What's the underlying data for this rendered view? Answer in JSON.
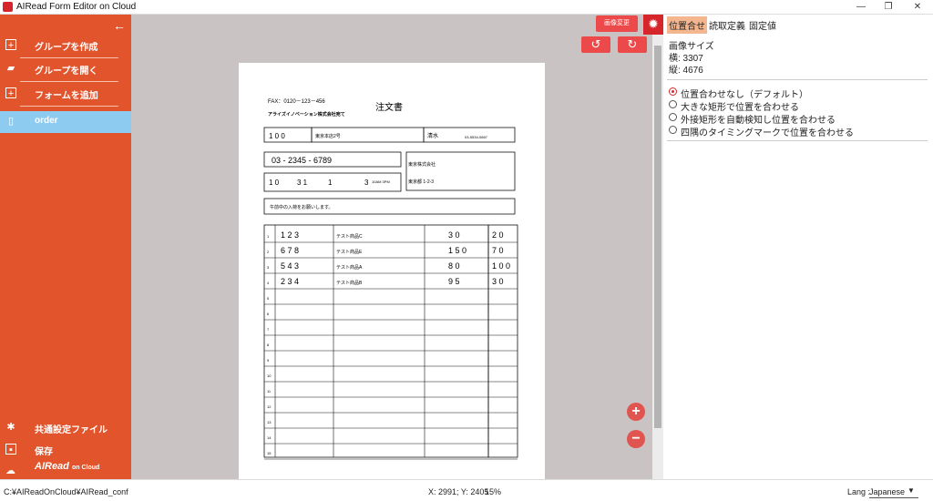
{
  "window": {
    "title": "AIRead Form Editor on Cloud",
    "min": "—",
    "max": "❐",
    "close": "✕"
  },
  "sidebar": {
    "back": "←",
    "items": [
      {
        "label": "グループを作成",
        "icon": "plus-square-icon"
      },
      {
        "label": "グループを開く",
        "icon": "folder-open-icon"
      },
      {
        "label": "フォームを追加",
        "icon": "plus-square-icon"
      },
      {
        "label": "order",
        "icon": "document-icon"
      }
    ],
    "bottom": [
      {
        "label": "共通設定ファイル",
        "icon": "gear-icon"
      },
      {
        "label": "保存",
        "icon": "save-icon"
      }
    ],
    "logo": "AIRead",
    "logo_suffix": "on Cloud"
  },
  "toolbar": {
    "image_change": "画像変更",
    "rotate_left": "↺",
    "rotate_right": "↻",
    "zoom_in": "+",
    "zoom_out": "−"
  },
  "document": {
    "fax": "FAX：0120－123－456",
    "title": "注文書",
    "to": "アライズイノベーション株式会社宛て",
    "customer_code": "1 0 0",
    "customer_name": "東京本店2号",
    "contact": "清水",
    "phone_small": "03-5534-0667",
    "phone": "03 - 2345 - 6789",
    "company": "東京株式会社",
    "date_digits": "1 0",
    "date_day": "3 1",
    "option1": "1",
    "option2": "3",
    "time_opts": "10AM 3PM",
    "address": "東京都 1-2-3",
    "remarks": "午前中の入荷をお願いします。",
    "rows": [
      {
        "n": "1",
        "code": "1 2 3",
        "name": "テスト商品C",
        "qty": "3 0",
        "price": "2 0"
      },
      {
        "n": "2",
        "code": "6 7 8",
        "name": "テスト商品E",
        "qty": "1 5 0",
        "price": "7 0"
      },
      {
        "n": "3",
        "code": "5 4 3",
        "name": "テスト商品A",
        "qty": "8 0",
        "price": "1 0 0"
      },
      {
        "n": "4",
        "code": "2 3 4",
        "name": "テスト商品B",
        "qty": "9 5",
        "price": "3 0"
      },
      {
        "n": "5"
      },
      {
        "n": "6"
      },
      {
        "n": "7"
      },
      {
        "n": "8"
      },
      {
        "n": "9"
      },
      {
        "n": "10"
      },
      {
        "n": "11"
      },
      {
        "n": "12"
      },
      {
        "n": "13"
      },
      {
        "n": "14"
      },
      {
        "n": "15"
      }
    ]
  },
  "right_panel": {
    "tabs": [
      "位置合せ",
      "読取定義",
      "固定値"
    ],
    "image_size_label": "画像サイズ",
    "width": "横: 3307",
    "height": "縦: 4676",
    "options": [
      {
        "label": "位置合わせなし（デフォルト）",
        "selected": true
      },
      {
        "label": "大きな矩形で位置を合わせる",
        "selected": false
      },
      {
        "label": "外接矩形を自動検知し位置を合わせる",
        "selected": false
      },
      {
        "label": "四隅のタイミングマークで位置を合わせる",
        "selected": false
      }
    ]
  },
  "status": {
    "path": "C:¥AIReadOnCloud¥AIRead_conf",
    "coords": "X: 2991; Y: 2405",
    "zoom": "15%",
    "lang_label": "Lang :",
    "lang_value": "Japanese"
  },
  "colors": {
    "accent": "#e2542c",
    "active": "#8ecbf0",
    "button": "#ec4a4a"
  }
}
